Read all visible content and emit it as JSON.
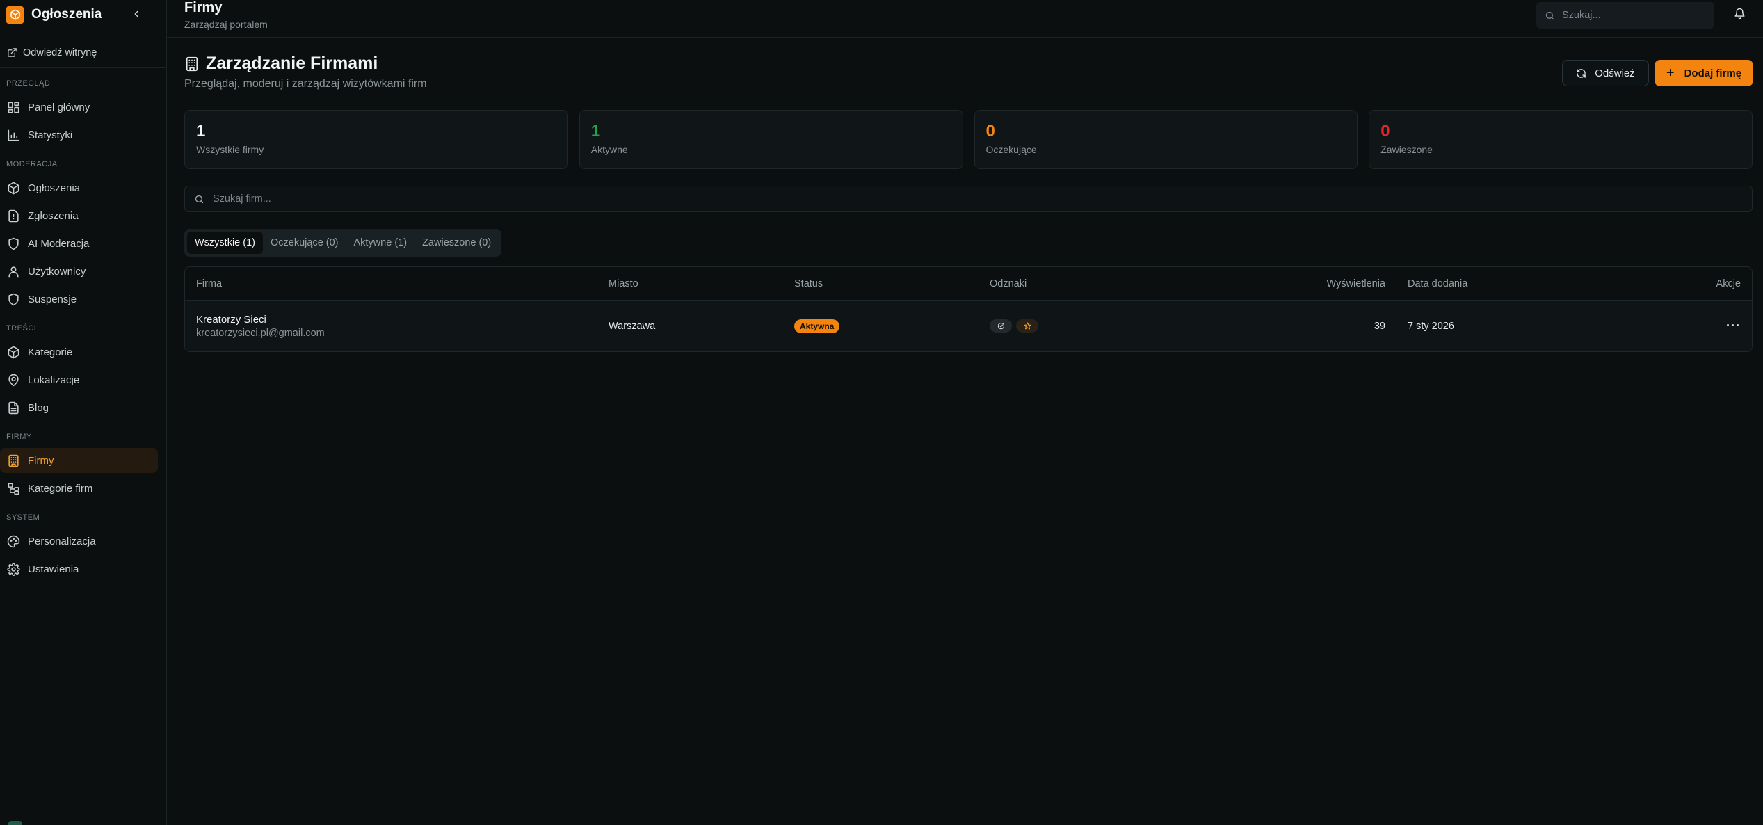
{
  "app": {
    "name": "Ogłoszenia"
  },
  "sidebar": {
    "visit_label": "Odwiedź witrynę",
    "sections": [
      {
        "label": "PRZEGLĄD",
        "items": [
          {
            "label": "Panel główny"
          },
          {
            "label": "Statystyki"
          }
        ]
      },
      {
        "label": "MODERACJA",
        "items": [
          {
            "label": "Ogłoszenia"
          },
          {
            "label": "Zgłoszenia"
          },
          {
            "label": "AI Moderacja"
          },
          {
            "label": "Użytkownicy"
          },
          {
            "label": "Suspensje"
          }
        ]
      },
      {
        "label": "TREŚCI",
        "items": [
          {
            "label": "Kategorie"
          },
          {
            "label": "Lokalizacje"
          },
          {
            "label": "Blog"
          }
        ]
      },
      {
        "label": "FIRMY",
        "items": [
          {
            "label": "Firmy"
          },
          {
            "label": "Kategorie firm"
          }
        ]
      },
      {
        "label": "SYSTEM",
        "items": [
          {
            "label": "Personalizacja"
          },
          {
            "label": "Ustawienia"
          }
        ]
      }
    ],
    "active_item": "Firmy"
  },
  "header": {
    "title": "Firmy",
    "subtitle": "Zarządzaj portalem",
    "search_placeholder": "Szukaj..."
  },
  "page": {
    "title": "Zarządzanie Firmami",
    "description": "Przeglądaj, moderuj i zarządzaj wizytówkami firm",
    "refresh_label": "Odśwież",
    "add_label": "Dodaj firmę"
  },
  "stats": [
    {
      "value": "1",
      "label": "Wszystkie firmy",
      "color": "#f2f4f5"
    },
    {
      "value": "1",
      "label": "Aktywne",
      "color": "#22a34a"
    },
    {
      "value": "0",
      "label": "Oczekujące",
      "color": "#f2840f"
    },
    {
      "value": "0",
      "label": "Zawieszone",
      "color": "#e0282e"
    }
  ],
  "filter": {
    "search_placeholder": "Szukaj firm..."
  },
  "tabs": [
    {
      "label": "Wszystkie (1)",
      "active": true
    },
    {
      "label": "Oczekujące (0)",
      "active": false
    },
    {
      "label": "Aktywne (1)",
      "active": false
    },
    {
      "label": "Zawieszone (0)",
      "active": false
    }
  ],
  "table": {
    "columns": [
      "Firma",
      "Miasto",
      "Status",
      "Odznaki",
      "Wyświetlenia",
      "Data dodania",
      "Akcje"
    ],
    "rows": [
      {
        "name": "Kreatorzy Sieci",
        "email": "kreatorzysieci.pl@gmail.com",
        "city": "Warszawa",
        "status": "Aktywna",
        "badges": [
          "verified-icon",
          "star-icon"
        ],
        "views": "39",
        "date": "7 sty 2026",
        "actions": "···"
      }
    ]
  },
  "colors": {
    "accent": "#f2840f",
    "background": "#0b0f10"
  }
}
